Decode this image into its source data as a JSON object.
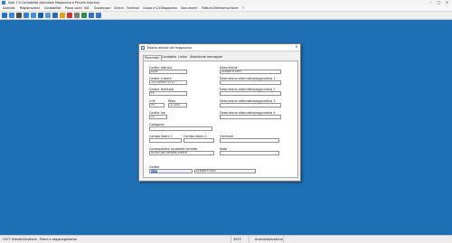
{
  "window": {
    "title": "Sabi 7.0 Contabilità Aziendale Magazzino e Piccola Impresa",
    "controls": [
      "–",
      "□",
      "×"
    ]
  },
  "menu": [
    "Azienda",
    "Registrazioni",
    "Contabilità",
    "Piano conti",
    "IVA",
    "Scadenzari",
    "Clienti",
    "Fornitori",
    "Cassa e C/C",
    "Magazzino",
    "Documenti",
    "Fattura Elettronica",
    "Varie",
    "?"
  ],
  "toolbar": [
    "folder-open-icon",
    "save-icon",
    "print-icon",
    "contacts-icon",
    "calendar-icon",
    "grid-icon",
    "window-icon",
    "table-icon",
    "chart-icon",
    "edit-icon",
    "tools-icon",
    "box-icon",
    "book-icon",
    "undo-icon"
  ],
  "status": {
    "left": "CS77 Utente/Gestione - Premi e raggiungimento",
    "year": "2023",
    "mode": "Anomalia/maximo"
  },
  "dialog": {
    "title": "Tabella articoli del magazzino",
    "close": "×",
    "tabs": [
      "Parametri",
      "Contabile",
      "Listini",
      "Statistiche",
      "Immagine"
    ],
    "fields": {
      "codice_articolo": {
        "label": "Codice articolo",
        "value": "A1/B"
      },
      "codice_a_barre": {
        "label": "Codice a barre",
        "value": "3333494973311"
      },
      "codice_fornitore": {
        "label": "Codice fornitore",
        "value": "PS"
      },
      "um": {
        "label": "U.M.",
        "value": "Ps"
      },
      "peso": {
        "label": "Peso",
        "value": "31,000"
      },
      "codice_iva": {
        "label": "Codice Iva",
        "value": "22"
      },
      "categoria": {
        "label": "Categoria",
        "value": ""
      },
      "campo_libero_1": {
        "label": "Campo libero 1",
        "value": ""
      },
      "campo_libero_2": {
        "label": "Campo libero 2",
        "value": ""
      },
      "contropartita": {
        "label": "Contropartita contabile vendite",
        "value": "Ricavi per vendite merce"
      },
      "descrizione": {
        "label": "Descrizione",
        "value": "Scarpe e stivi"
      },
      "desc_agg_1": {
        "label": "Descrizione alternativa/aggiuntiva 1",
        "value": ""
      },
      "desc_agg_2": {
        "label": "Descrizione alternativa/aggiuntiva 2",
        "value": ""
      },
      "desc_agg_3": {
        "label": "Descrizione alternativa/aggiuntiva 3",
        "value": ""
      },
      "desc_agg_4": {
        "label": "Descrizione alternativa/aggiuntiva 4",
        "value": ""
      },
      "fornitore": {
        "label": "Fornitore",
        "value": ""
      },
      "note": {
        "label": "Note",
        "value": ""
      },
      "codice": {
        "label": "Codice",
        "value": "A1/B",
        "description": "Scarpe e stivi"
      }
    }
  },
  "colors": {
    "desktop": "#1f6fb5",
    "selection": "#3a78c8"
  }
}
